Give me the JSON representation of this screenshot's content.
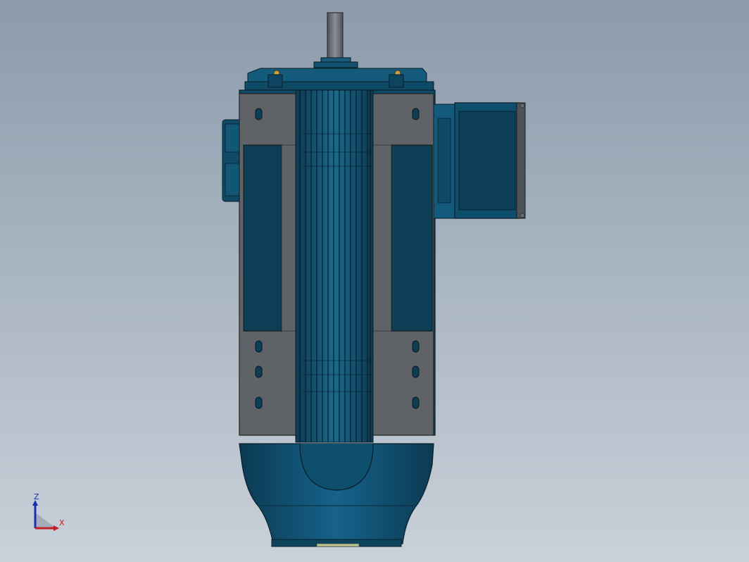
{
  "viewport": {
    "background_top": "#8c9aaa",
    "background_bottom": "#c9d1d9"
  },
  "model": {
    "body_color": "#0f4f6e",
    "body_dark": "#0a3346",
    "panel_color": "#5f6266",
    "inset_color": "#0c3f56",
    "shaft_color": "#6d7378"
  },
  "triad": {
    "z_label": "Z",
    "x_label": "X",
    "z_color": "#1a2fb0",
    "x_color": "#c0202a"
  }
}
